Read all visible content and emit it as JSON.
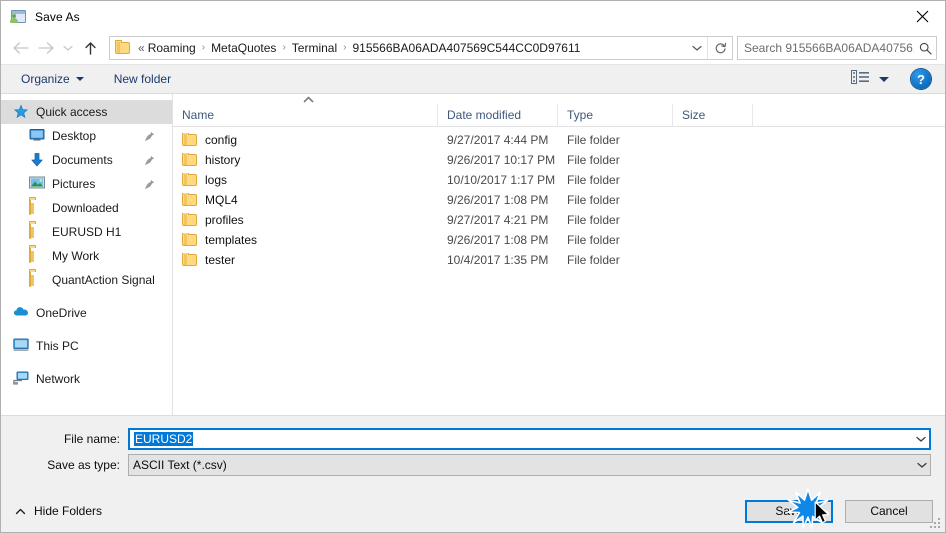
{
  "window": {
    "title": "Save As",
    "icon": "save-as-window-icon",
    "close_label": "Close"
  },
  "nav": {
    "back": "Back",
    "forward": "Forward",
    "recent": "Recent locations",
    "up": "Up to Roaming",
    "refresh": "Refresh"
  },
  "address": {
    "folder_icon": "folder-icon",
    "prefix": "«",
    "separator": "›",
    "crumbs": [
      "Roaming",
      "MetaQuotes",
      "Terminal",
      "915566BA06ADA407569C544CC0D97611"
    ]
  },
  "search": {
    "placeholder": "Search 915566BA06ADA40756...",
    "icon": "search-icon"
  },
  "toolbar": {
    "organize": "Organize",
    "new_folder": "New folder",
    "view_icon": "list-view-icon",
    "help": "?"
  },
  "sidebar": {
    "items": [
      {
        "label": "Quick access",
        "icon": "star-icon",
        "selected": true,
        "pinned": false,
        "level": "root"
      },
      {
        "label": "Desktop",
        "icon": "monitor-icon",
        "selected": false,
        "pinned": true,
        "level": "indent"
      },
      {
        "label": "Documents",
        "icon": "download-arrow-icon",
        "selected": false,
        "pinned": true,
        "level": "indent"
      },
      {
        "label": "Pictures",
        "icon": "picture-icon",
        "selected": false,
        "pinned": true,
        "level": "indent"
      },
      {
        "label": "Downloaded",
        "icon": "folder-icon",
        "selected": false,
        "pinned": false,
        "level": "indent"
      },
      {
        "label": "EURUSD H1",
        "icon": "folder-icon",
        "selected": false,
        "pinned": false,
        "level": "indent"
      },
      {
        "label": "My Work",
        "icon": "folder-icon",
        "selected": false,
        "pinned": false,
        "level": "indent"
      },
      {
        "label": "QuantAction Signal",
        "icon": "folder-icon",
        "selected": false,
        "pinned": false,
        "level": "indent"
      }
    ],
    "roots": [
      {
        "label": "OneDrive",
        "icon": "onedrive-cloud-icon"
      },
      {
        "label": "This PC",
        "icon": "this-pc-icon"
      },
      {
        "label": "Network",
        "icon": "network-icon"
      }
    ]
  },
  "filelist": {
    "columns": [
      "Name",
      "Date modified",
      "Type",
      "Size"
    ],
    "sort_indicator": "ascending",
    "rows": [
      {
        "name": "config",
        "date": "9/27/2017 4:44 PM",
        "type": "File folder",
        "size": ""
      },
      {
        "name": "history",
        "date": "9/26/2017 10:17 PM",
        "type": "File folder",
        "size": ""
      },
      {
        "name": "logs",
        "date": "10/10/2017 1:17 PM",
        "type": "File folder",
        "size": ""
      },
      {
        "name": "MQL4",
        "date": "9/26/2017 1:08 PM",
        "type": "File folder",
        "size": ""
      },
      {
        "name": "profiles",
        "date": "9/27/2017 4:21 PM",
        "type": "File folder",
        "size": ""
      },
      {
        "name": "templates",
        "date": "9/26/2017 1:08 PM",
        "type": "File folder",
        "size": ""
      },
      {
        "name": "tester",
        "date": "10/4/2017 1:35 PM",
        "type": "File folder",
        "size": ""
      }
    ]
  },
  "form": {
    "filename_label": "File name:",
    "filename_value": "EURUSD2",
    "filetype_label": "Save as type:",
    "filetype_value": "ASCII Text (*.csv)"
  },
  "footer": {
    "hide_folders": "Hide Folders",
    "save": "Save",
    "cancel": "Cancel"
  },
  "colors": {
    "accent": "#0078d7",
    "folder": "#ffd97f",
    "chrome": "#f0f0f0",
    "header_text": "#40587c"
  }
}
